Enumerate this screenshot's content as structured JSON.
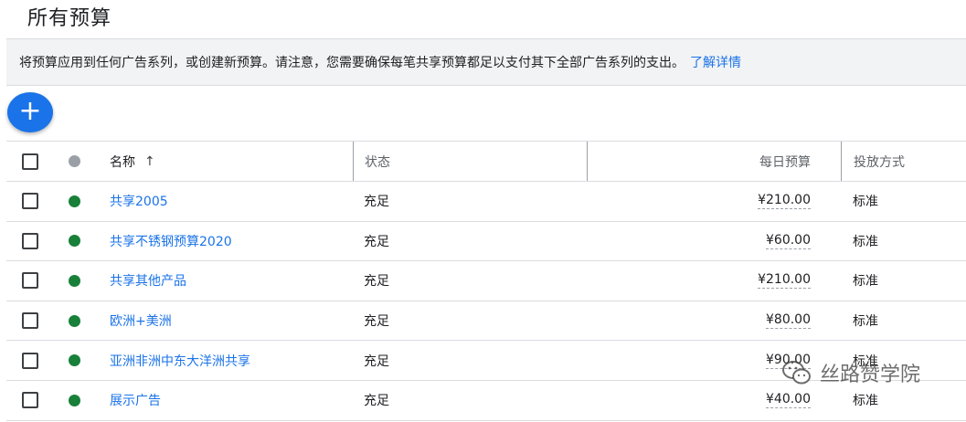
{
  "page_title": "所有预算",
  "banner": {
    "text": "将预算应用到任何广告系列，或创建新预算。请注意，您需要确保每笔共享预算都足以支付其下全部广告系列的支出。",
    "link": "了解详情"
  },
  "fab": {
    "label": "+"
  },
  "colors": {
    "accent": "#1a73e8",
    "status_enabled": "#188038",
    "status_header": "#9aa0a6"
  },
  "table": {
    "headers": {
      "name": "名称",
      "sort_icon": "↑",
      "status": "状态",
      "daily_budget": "每日预算",
      "delivery": "投放方式"
    },
    "rows": [
      {
        "name": "共享2005",
        "status": "充足",
        "budget": "¥210.00",
        "delivery": "标准"
      },
      {
        "name": "共享不锈钢预算2020",
        "status": "充足",
        "budget": "¥60.00",
        "delivery": "标准"
      },
      {
        "name": "共享其他产品",
        "status": "充足",
        "budget": "¥210.00",
        "delivery": "标准"
      },
      {
        "name": "欧洲+美洲",
        "status": "充足",
        "budget": "¥80.00",
        "delivery": "标准"
      },
      {
        "name": "亚洲非洲中东大洋洲共享",
        "status": "充足",
        "budget": "¥90.00",
        "delivery": "标准"
      },
      {
        "name": "展示广告",
        "status": "充足",
        "budget": "¥40.00",
        "delivery": "标准"
      }
    ]
  },
  "watermark": {
    "text": "丝路赞学院",
    "icon": "wechat-icon"
  }
}
